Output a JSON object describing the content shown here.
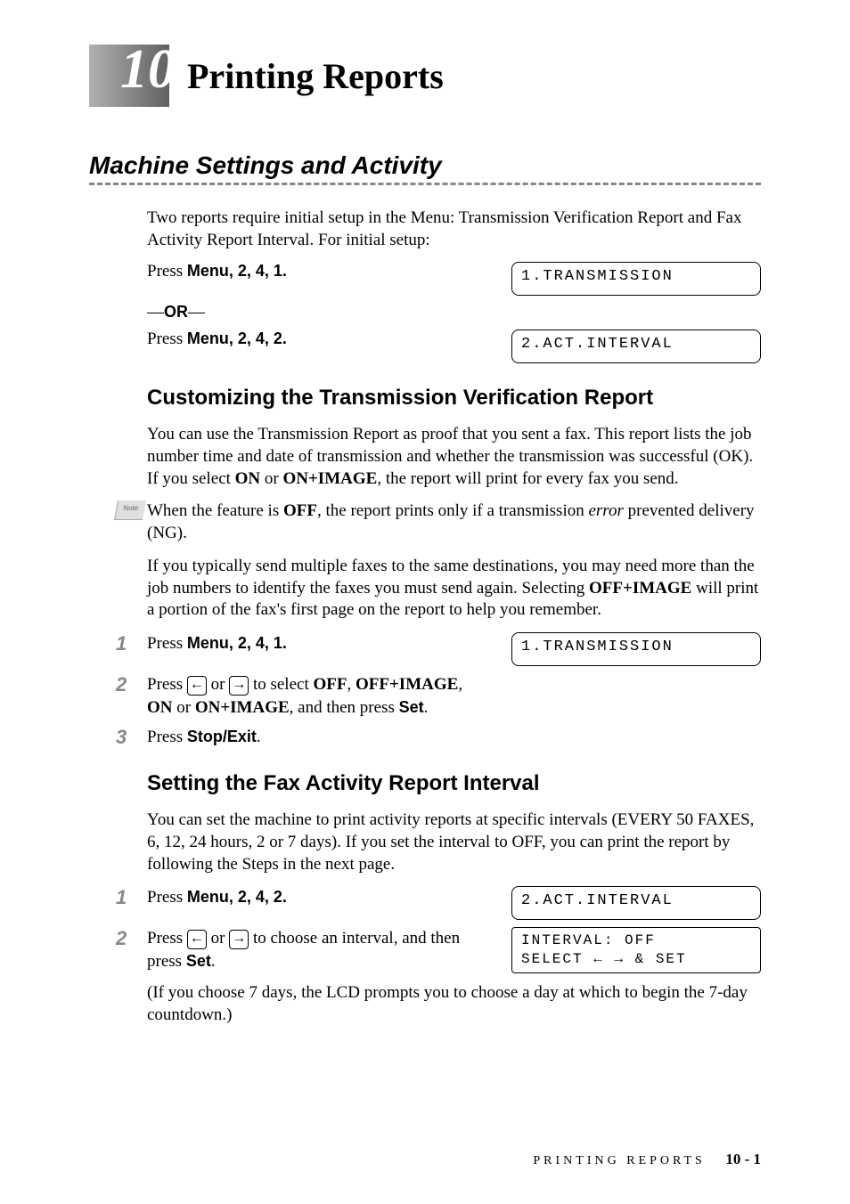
{
  "chapter": {
    "number": "10",
    "title": "Printing Reports"
  },
  "section": {
    "title": "Machine Settings and Activity",
    "intro": "Two reports require initial setup in the Menu: Transmission Verification Report and Fax Activity Report Interval. For initial setup:",
    "press1_prefix": "Press ",
    "press1_menu": "Menu",
    "press1_keys": ", 2, 4, 1.",
    "or": "—OR—",
    "press2_prefix": "Press ",
    "press2_menu": "Menu",
    "press2_keys": ", 2, 4, 2.",
    "lcd1": "1.TRANSMISSION",
    "lcd2": "2.ACT.INTERVAL"
  },
  "subsection1": {
    "title": "Customizing the Transmission Verification Report",
    "para1_a": "You can use the Transmission Report as proof that you sent a fax. This report lists the job number time and date of transmission and whether the transmission was successful (OK). If you select ",
    "on": "ON",
    "or_text": " or ",
    "onimage": "ON+IMAGE",
    "para1_b": ", the report will print for every fax you send.",
    "note_a": "When the feature is ",
    "off": "OFF",
    "note_b": ", the report prints only if a transmission ",
    "error": "error",
    "note_c": " prevented delivery (NG).",
    "para2_a": "If you typically send multiple faxes to the same destinations, you may need more than the job numbers to identify the faxes you must send again. Selecting ",
    "offimage": "OFF+IMAGE",
    "para2_b": " will print a portion of the fax's first page on the report to help you remember.",
    "step1_prefix": "Press ",
    "step1_menu": "Menu",
    "step1_keys": ", 2, 4, 1.",
    "step2_a": "Press ",
    "step2_b": " or ",
    "step2_c": " to select ",
    "step2_off": "OFF",
    "step2_d": ", ",
    "step2_offimage": "OFF+IMAGE",
    "step2_e": ", ",
    "step2_on": "ON",
    "step2_f": " or ",
    "step2_onimage": "ON+IMAGE",
    "step2_g": ", and then press ",
    "step2_set": "Set",
    "step2_h": ".",
    "step3_a": "Press ",
    "step3_stop": "Stop/Exit",
    "step3_b": ".",
    "lcd": "1.TRANSMISSION",
    "note_label": "Note"
  },
  "subsection2": {
    "title": "Setting the Fax Activity Report Interval",
    "para": "You can set the machine to print activity reports at specific intervals (EVERY 50 FAXES, 6, 12, 24 hours, 2 or 7 days). If you set the interval to OFF, you can print the report by following the Steps in the next page.",
    "step1_prefix": "Press ",
    "step1_menu": "Menu",
    "step1_keys": ", 2, 4, 2.",
    "step2_a": "Press ",
    "step2_b": " or ",
    "step2_c": " to choose an interval, and then press ",
    "step2_set": "Set",
    "step2_d": ".",
    "para2": "(If you choose 7 days, the LCD prompts you to choose a day at which to begin the 7-day countdown.)",
    "lcd1": "2.ACT.INTERVAL",
    "lcd2_line1": "INTERVAL: OFF",
    "lcd2_line2": "SELECT ← → & SET"
  },
  "footer": {
    "text": "PRINTING REPORTS",
    "page": "10 - 1"
  },
  "arrows": {
    "left": "←",
    "right": "→"
  }
}
